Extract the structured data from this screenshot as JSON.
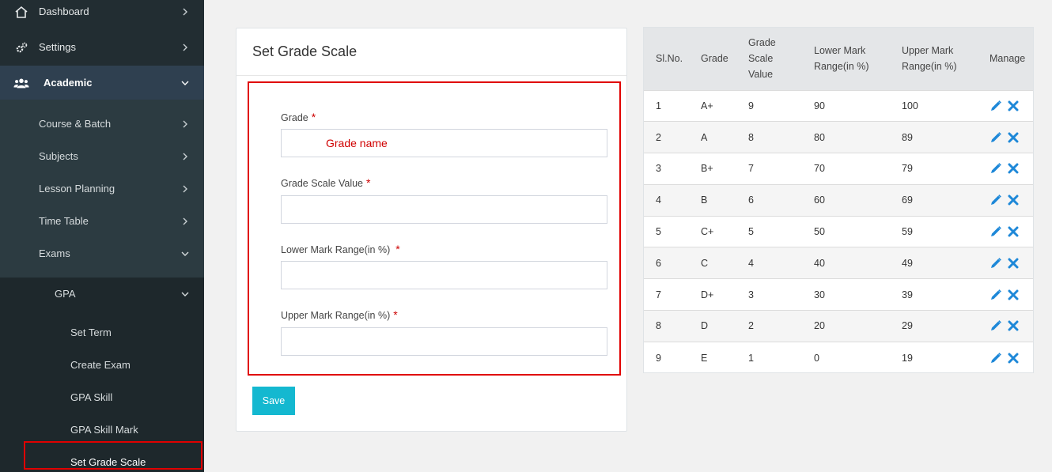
{
  "sidebar": {
    "dashboard": "Dashboard",
    "settings": "Settings",
    "academic": "Academic",
    "academic_sub": [
      {
        "label": "Course & Batch"
      },
      {
        "label": "Subjects"
      },
      {
        "label": "Lesson Planning"
      },
      {
        "label": "Time Table"
      },
      {
        "label": "Exams"
      }
    ],
    "gpa": "GPA",
    "gpa_sub": [
      {
        "label": "Set Term"
      },
      {
        "label": "Create Exam"
      },
      {
        "label": "GPA Skill"
      },
      {
        "label": "GPA Skill Mark"
      },
      {
        "label": "Set Grade Scale"
      }
    ]
  },
  "form": {
    "title": "Set Grade Scale",
    "required_mark": "*",
    "grade_label": "Grade",
    "grade_placeholder": "Grade name",
    "grade_scale_label": "Grade Scale Value",
    "lower_label": "Lower Mark Range(in %)",
    "upper_label": "Upper Mark Range(in %)",
    "save": "Save"
  },
  "table": {
    "headers": [
      "Sl.No.",
      "Grade",
      "Grade Scale Value",
      "Lower Mark Range(in %)",
      "Upper Mark Range(in %)",
      "Manage"
    ],
    "rows": [
      {
        "sl": "1",
        "grade": "A+",
        "scale": "9",
        "lower": "90",
        "upper": "100"
      },
      {
        "sl": "2",
        "grade": "A",
        "scale": "8",
        "lower": "80",
        "upper": "89"
      },
      {
        "sl": "3",
        "grade": "B+",
        "scale": "7",
        "lower": "70",
        "upper": "79"
      },
      {
        "sl": "4",
        "grade": "B",
        "scale": "6",
        "lower": "60",
        "upper": "69"
      },
      {
        "sl": "5",
        "grade": "C+",
        "scale": "5",
        "lower": "50",
        "upper": "59"
      },
      {
        "sl": "6",
        "grade": "C",
        "scale": "4",
        "lower": "40",
        "upper": "49"
      },
      {
        "sl": "7",
        "grade": "D+",
        "scale": "3",
        "lower": "30",
        "upper": "39"
      },
      {
        "sl": "8",
        "grade": "D",
        "scale": "2",
        "lower": "20",
        "upper": "29"
      },
      {
        "sl": "9",
        "grade": "E",
        "scale": "1",
        "lower": "0",
        "upper": "19"
      }
    ]
  },
  "colors": {
    "accent": "#14b8d0",
    "icon_blue": "#1e88d8",
    "highlight": "#e00000"
  }
}
